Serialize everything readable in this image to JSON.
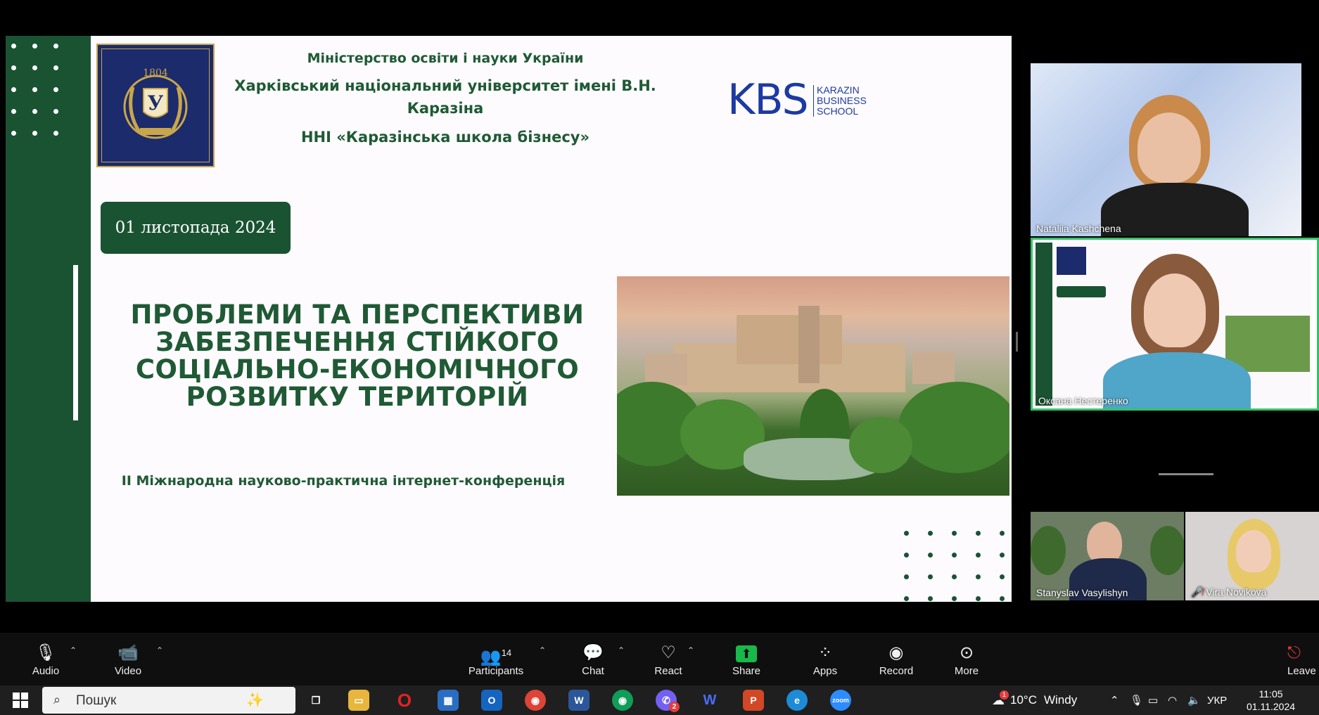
{
  "slide": {
    "ministry": "Міністерство освіти і науки України",
    "university_line1": "Харківський національний університет імені В.Н.",
    "university_line2": "Каразіна",
    "school": "ННІ «Каразінська школа бізнесу»",
    "kbs_logo": "KBS",
    "kbs_sub1": "KARAZIN",
    "kbs_sub2": "BUSINESS",
    "kbs_sub3": "SCHOOL",
    "emblem_year": "1804",
    "date": "01 листопада 2024",
    "title_lines": [
      "ПРОБЛЕМИ ТА ПЕРСПЕКТИВИ",
      "ЗАБЕЗПЕЧЕННЯ СТІЙКОГО",
      "СОЦІАЛЬНО-ЕКОНОМІЧНОГО",
      "РОЗВИТКУ ТЕРИТОРІЙ"
    ],
    "subtitle": "ІІ Міжнародна науково-практична інтернет-конференція",
    "brand_color": "#1a5332"
  },
  "participants": [
    {
      "name": "Nataliia Kashchena"
    },
    {
      "name": "Оксана Нестеренко",
      "speaking": true
    },
    {
      "name": "Stanyslav Vasylishyn"
    },
    {
      "name": "Vira Novikova",
      "muted": true
    }
  ],
  "toolbar": {
    "audio": "Audio",
    "video": "Video",
    "participants": "Participants",
    "participants_count": "14",
    "chat": "Chat",
    "react": "React",
    "share": "Share",
    "apps": "Apps",
    "record": "Record",
    "more": "More",
    "leave": "Leave",
    "share_color": "#19b84a"
  },
  "taskbar": {
    "search_placeholder": "Пошук",
    "weather_temp": "10°C",
    "weather_desc": "Windy",
    "lang": "УКР",
    "time": "11:05",
    "date": "01.11.2024",
    "notif_badge": "1",
    "viber_badge": "2",
    "zoom_label": "zoom"
  }
}
